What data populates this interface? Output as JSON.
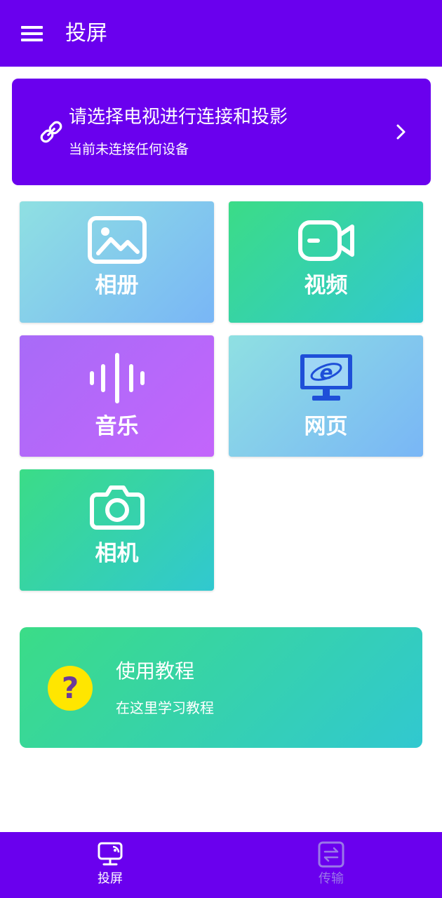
{
  "appbar": {
    "title": "投屏",
    "menu_icon": "menu-icon"
  },
  "connect": {
    "title": "请选择电视进行连接和投影",
    "subtitle": "当前未连接任何设备",
    "link_icon": "link-icon",
    "chevron_icon": "chevron-right-icon"
  },
  "tiles": [
    {
      "label": "相册",
      "icon": "image-icon"
    },
    {
      "label": "视频",
      "icon": "video-camera-icon"
    },
    {
      "label": "音乐",
      "icon": "sound-wave-icon"
    },
    {
      "label": "网页",
      "icon": "browser-monitor-icon"
    },
    {
      "label": "相机",
      "icon": "camera-icon"
    }
  ],
  "tutorial": {
    "title": "使用教程",
    "subtitle": "在这里学习教程",
    "icon": "help-icon"
  },
  "bottom_nav": [
    {
      "label": "投屏",
      "icon": "screen-cast-icon",
      "active": true
    },
    {
      "label": "传输",
      "icon": "transfer-icon",
      "active": false
    }
  ],
  "colors": {
    "primary": "#6a00ee",
    "tile_blue": [
      "#8fe0e2",
      "#79b6f6"
    ],
    "tile_green": [
      "#3bdc87",
      "#31c8d0"
    ],
    "tile_purple": [
      "#a86bf8",
      "#c365fb"
    ],
    "help_yellow": "#ffe600",
    "inactive_nav": "#9a78e8"
  }
}
